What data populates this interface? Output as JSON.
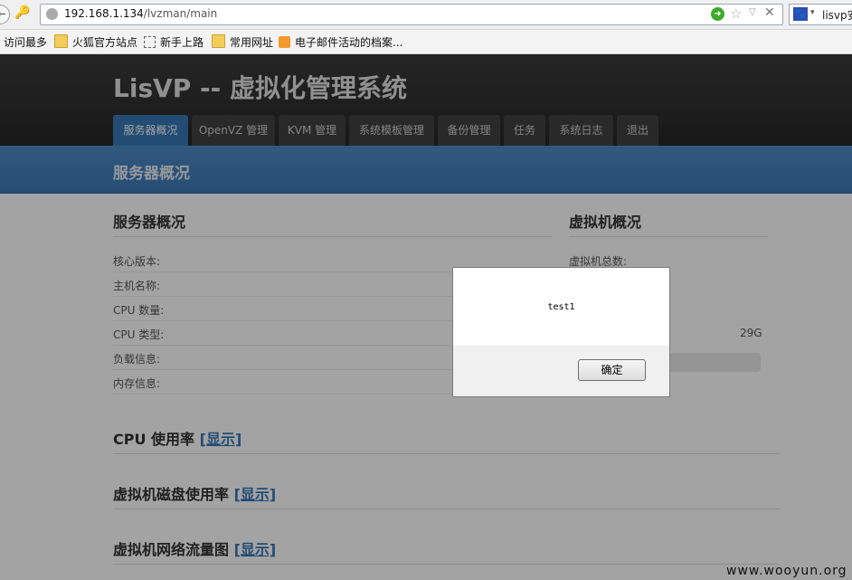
{
  "browser": {
    "nav_back_glyph": "←",
    "tools_glyph": "🔑",
    "url_host": "192.168.1.134",
    "url_path": "/lvzman/main",
    "go_glyph": "➜",
    "star_glyph": "☆",
    "dropdown_glyph": "▽",
    "close_glyph": "✕",
    "search_engine_glyph": "🐾",
    "search_text": "lisvp安"
  },
  "bookmarks": [
    {
      "label": "访问最多",
      "icon": "none"
    },
    {
      "label": "火狐官方站点",
      "icon": "folder-icon"
    },
    {
      "label": "新手上路",
      "icon": "dashed-page-icon"
    },
    {
      "label": "常用网址",
      "icon": "folder-icon"
    },
    {
      "label": "电子邮件活动的档案...",
      "icon": "rss-icon"
    }
  ],
  "site": {
    "title": "LisVP -- 虚拟化管理系统",
    "tabs": [
      "服务器概况",
      "OpenVZ 管理",
      "KVM 管理",
      "系统模板管理",
      "备份管理",
      "任务",
      "系统日志",
      "退出"
    ],
    "active_tab": "服务器概况",
    "page_heading": "服务器概况"
  },
  "server_overview": {
    "title": "服务器概况",
    "rows": [
      "核心版本:",
      "主机名称:",
      "CPU 数量:",
      "CPU 类型:",
      "负载信息:",
      "内存信息:"
    ]
  },
  "vm_overview": {
    "title": "虚拟机概况",
    "total_label": "虚拟机总数:",
    "value": "29G"
  },
  "sections": [
    {
      "title": "CPU 使用率",
      "link": "[显示]"
    },
    {
      "title": "虚拟机磁盘使用率",
      "link": "[显示]"
    },
    {
      "title": "虚拟机网络流量图",
      "link": "[显示]"
    }
  ],
  "dialog": {
    "message": "test1",
    "ok_label": "确定"
  },
  "watermark": "www.wooyun.org",
  "colors": {
    "accent": "#3678b4",
    "header_bg": "#2f2f2f",
    "go_green": "#3eaa2a"
  }
}
